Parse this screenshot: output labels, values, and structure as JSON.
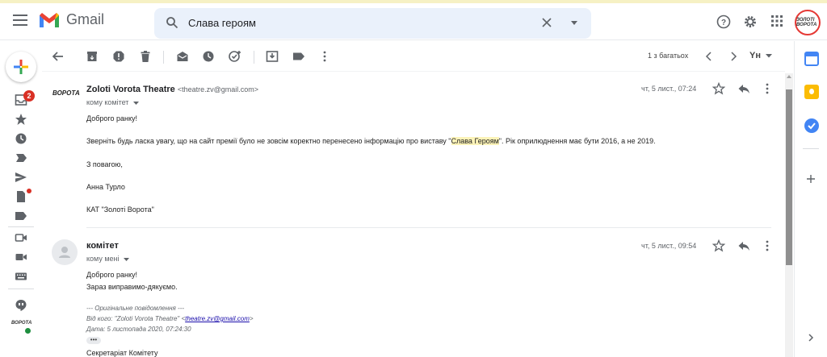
{
  "header": {
    "app_name": "Gmail",
    "search_value": "Слава героям",
    "avatar_text": "ЗОЛОТІ ВОРОТА"
  },
  "leftrail": {
    "inbox_badge": "2",
    "rail_logo_text": "ВОРОТА"
  },
  "toolbar": {
    "pagination": "1 з багатьох",
    "language": "Yн"
  },
  "messages": [
    {
      "sender_name": "Zoloti Vorota Theatre",
      "sender_email": "<theatre.zv@gmail.com>",
      "to_line": "кому комітет",
      "date": "чт, 5 лист., 07:24",
      "avatar_text": "ВОРОТА",
      "lines": {
        "greeting": "Доброго ранку!",
        "para_before": "Зверніть будь ласка увагу, що на сайт премії було не зовсім коректно перенесено інформацію про виставу \"",
        "para_highlight": "Слава Героям",
        "para_after": "\". Рік оприлюднення має бути 2016, а не 2019.",
        "regards": "З повагою,",
        "name": "Анна Турло",
        "org": "КАТ \"Золоті Ворота\""
      }
    },
    {
      "sender_name": "комітет",
      "to_line": "кому мені",
      "date": "чт, 5 лист., 09:54",
      "lines": {
        "greeting": "Доброго ранку!",
        "reply": "Зараз виправимо-дякуємо.",
        "orig_header": "--- Оригінальне повідомлення ---",
        "from_label": "Від кого: \"Zoloti Vorota Theatre\" <",
        "from_email": "theatre.zv@gmail.com",
        "from_end": ">",
        "date_line": "Дата: 5 листопада 2020, 07:24:30",
        "ellipsis": "•••",
        "signature": "Секретаріат Комітету"
      }
    }
  ],
  "colors": {
    "accent_red": "#d93025",
    "search_bg": "#eaf1fb",
    "highlight": "#fcf3b8"
  }
}
